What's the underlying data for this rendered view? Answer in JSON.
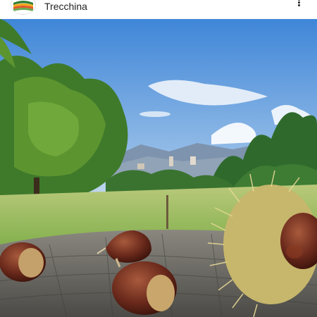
{
  "post": {
    "username": "Trecchina",
    "avatar_icon": "trecchina-logo-icon",
    "more_icon": "more-options-icon",
    "image_subject": "chestnuts-on-tree-stump-landscape"
  },
  "colors": {
    "sky_top": "#3f86d8",
    "sky_bottom": "#bcd7ee",
    "grass": "#8fbf52",
    "chestnut": "#6a2a1e",
    "stump": "#5e5e5a"
  }
}
